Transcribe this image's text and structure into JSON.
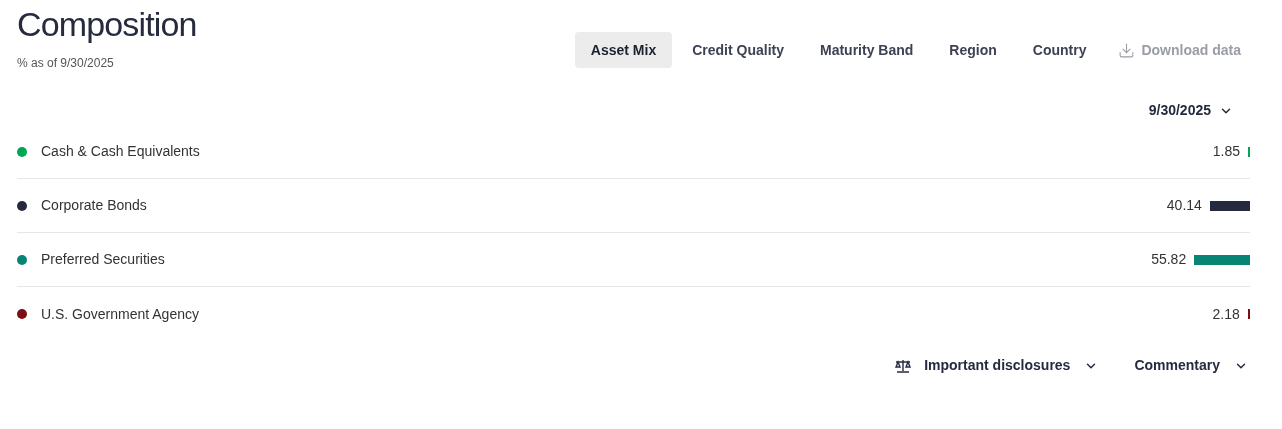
{
  "title": "Composition",
  "subtitle": "% as of 9/30/2025",
  "tabs": [
    {
      "label": "Asset Mix",
      "selected": true
    },
    {
      "label": "Credit Quality",
      "selected": false
    },
    {
      "label": "Maturity Band",
      "selected": false
    },
    {
      "label": "Region",
      "selected": false
    },
    {
      "label": "Country",
      "selected": false
    }
  ],
  "download": {
    "label": "Download data",
    "disabled": true
  },
  "date_select": {
    "value": "9/30/2025"
  },
  "rows": [
    {
      "name": "Cash & Cash Equivalents",
      "value": "1.85",
      "color": "#00a651"
    },
    {
      "name": "Corporate Bonds",
      "value": "40.14",
      "color": "#262a3e"
    },
    {
      "name": "Preferred Securities",
      "value": "55.82",
      "color": "#088475"
    },
    {
      "name": "U.S. Government Agency",
      "value": "2.18",
      "color": "#7d0e14"
    }
  ],
  "footer": [
    {
      "label": "Important disclosures",
      "kind": "disclosures"
    },
    {
      "label": "Commentary",
      "kind": "plain"
    }
  ]
}
